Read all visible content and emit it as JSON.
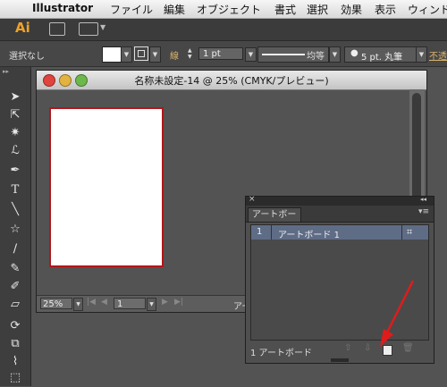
{
  "menubar": {
    "app_name": "Illustrator",
    "items": [
      "ファイル",
      "編集",
      "オブジェクト",
      "書式",
      "選択",
      "効果",
      "表示",
      "ウィンド"
    ]
  },
  "appbar": {
    "logo": "Ai"
  },
  "control_bar": {
    "selection": "選択なし",
    "stroke_label": "線",
    "stroke_weight": "1 pt",
    "profile_label": "均等",
    "brush_label": "5 pt. 丸筆",
    "opacity_label": "不透"
  },
  "document": {
    "title": "名称未設定-14 @ 25% (CMYK/プレビュー)",
    "zoom": "25%",
    "page": "1",
    "status_fragment": "アー"
  },
  "panel": {
    "tab": "アートボード",
    "rows": [
      {
        "number": "1",
        "name": "アートボード 1"
      }
    ],
    "footer_count": "1 アートボード"
  },
  "colors": {
    "accent": "#f0a229",
    "artboard_border": "#b1161b",
    "selected_row": "#5f6c86",
    "arrow": "#e01b1b"
  }
}
